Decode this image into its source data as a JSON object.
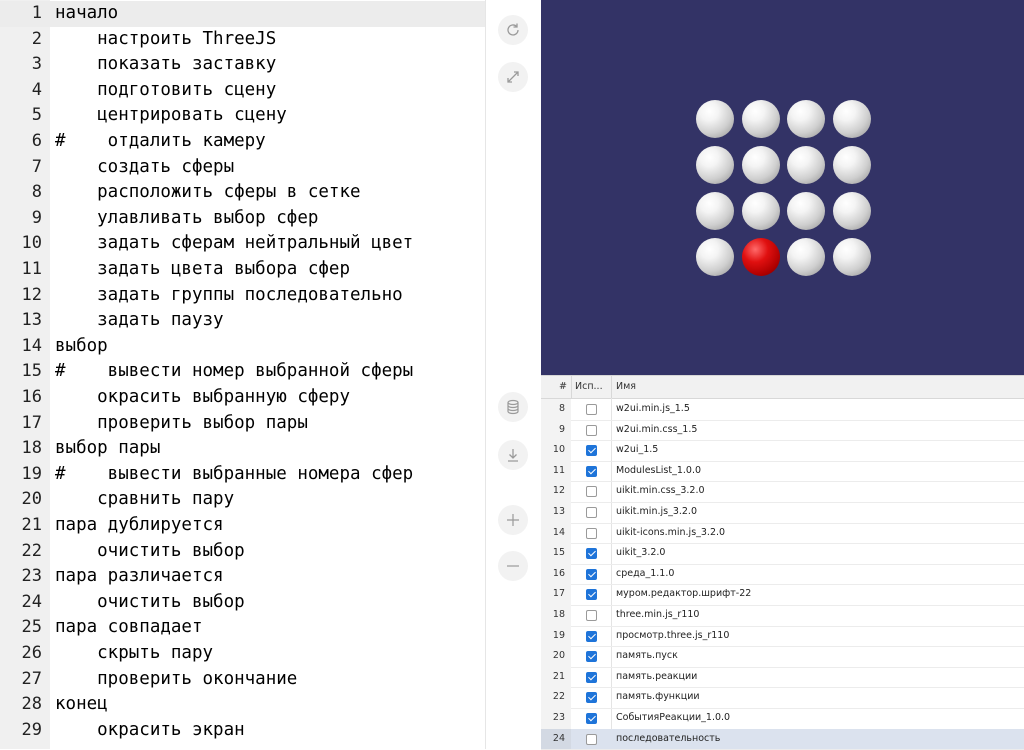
{
  "editor": {
    "lines": [
      "начало",
      "    настроить ThreeJS",
      "    показать заставку",
      "    подготовить сцену",
      "    центрировать сцену",
      "#    отдалить камеру",
      "    создать сферы",
      "    расположить сферы в сетке",
      "    улавливать выбор сфер",
      "    задать сферам нейтральный цвет",
      "    задать цвета выбора сфер",
      "    задать группы последовательно",
      "    задать паузу",
      "выбор",
      "#    вывести номер выбранной сферы",
      "    окрасить выбранную сферу",
      "    проверить выбор пары",
      "выбор пары",
      "#    вывести выбранные номера сфер",
      "    сравнить пару",
      "пара дублируется",
      "    очистить выбор",
      "пара различается",
      "    очистить выбор",
      "пара совпадает",
      "    скрыть пару",
      "    проверить окончание",
      "конец",
      "    окрасить экран"
    ]
  },
  "tools": [
    {
      "name": "reload-icon"
    },
    {
      "name": "fullscreen-icon"
    },
    {
      "name": "database-icon"
    },
    {
      "name": "download-icon"
    },
    {
      "name": "plus-icon"
    },
    {
      "name": "minus-icon"
    }
  ],
  "scene": {
    "background": "#333366",
    "sphere_color": "#ffffff",
    "selected_color": "#ee1111",
    "rows": 4,
    "cols": 4,
    "selected": [
      13
    ]
  },
  "grid": {
    "headers": {
      "num": "#",
      "use": "Исп...",
      "name": "Имя"
    },
    "rows": [
      {
        "num": "8",
        "checked": false,
        "name": "w2ui.min.js_1.5"
      },
      {
        "num": "9",
        "checked": false,
        "name": "w2ui.min.css_1.5"
      },
      {
        "num": "10",
        "checked": true,
        "name": "w2ui_1.5"
      },
      {
        "num": "11",
        "checked": true,
        "name": "ModulesList_1.0.0"
      },
      {
        "num": "12",
        "checked": false,
        "name": "uikit.min.css_3.2.0"
      },
      {
        "num": "13",
        "checked": false,
        "name": "uikit.min.js_3.2.0"
      },
      {
        "num": "14",
        "checked": false,
        "name": "uikit-icons.min.js_3.2.0"
      },
      {
        "num": "15",
        "checked": true,
        "name": "uikit_3.2.0"
      },
      {
        "num": "16",
        "checked": true,
        "name": "среда_1.1.0"
      },
      {
        "num": "17",
        "checked": true,
        "name": "муром.редактор.шрифт-22"
      },
      {
        "num": "18",
        "checked": false,
        "name": "three.min.js_r110"
      },
      {
        "num": "19",
        "checked": true,
        "name": "просмотр.three.js_r110"
      },
      {
        "num": "20",
        "checked": true,
        "name": "память.пуск"
      },
      {
        "num": "21",
        "checked": true,
        "name": "память.реакции"
      },
      {
        "num": "22",
        "checked": true,
        "name": "память.функции"
      },
      {
        "num": "23",
        "checked": true,
        "name": "СобытияРеакции_1.0.0"
      },
      {
        "num": "24",
        "checked": false,
        "name": "последовательность",
        "selected": true
      }
    ]
  }
}
